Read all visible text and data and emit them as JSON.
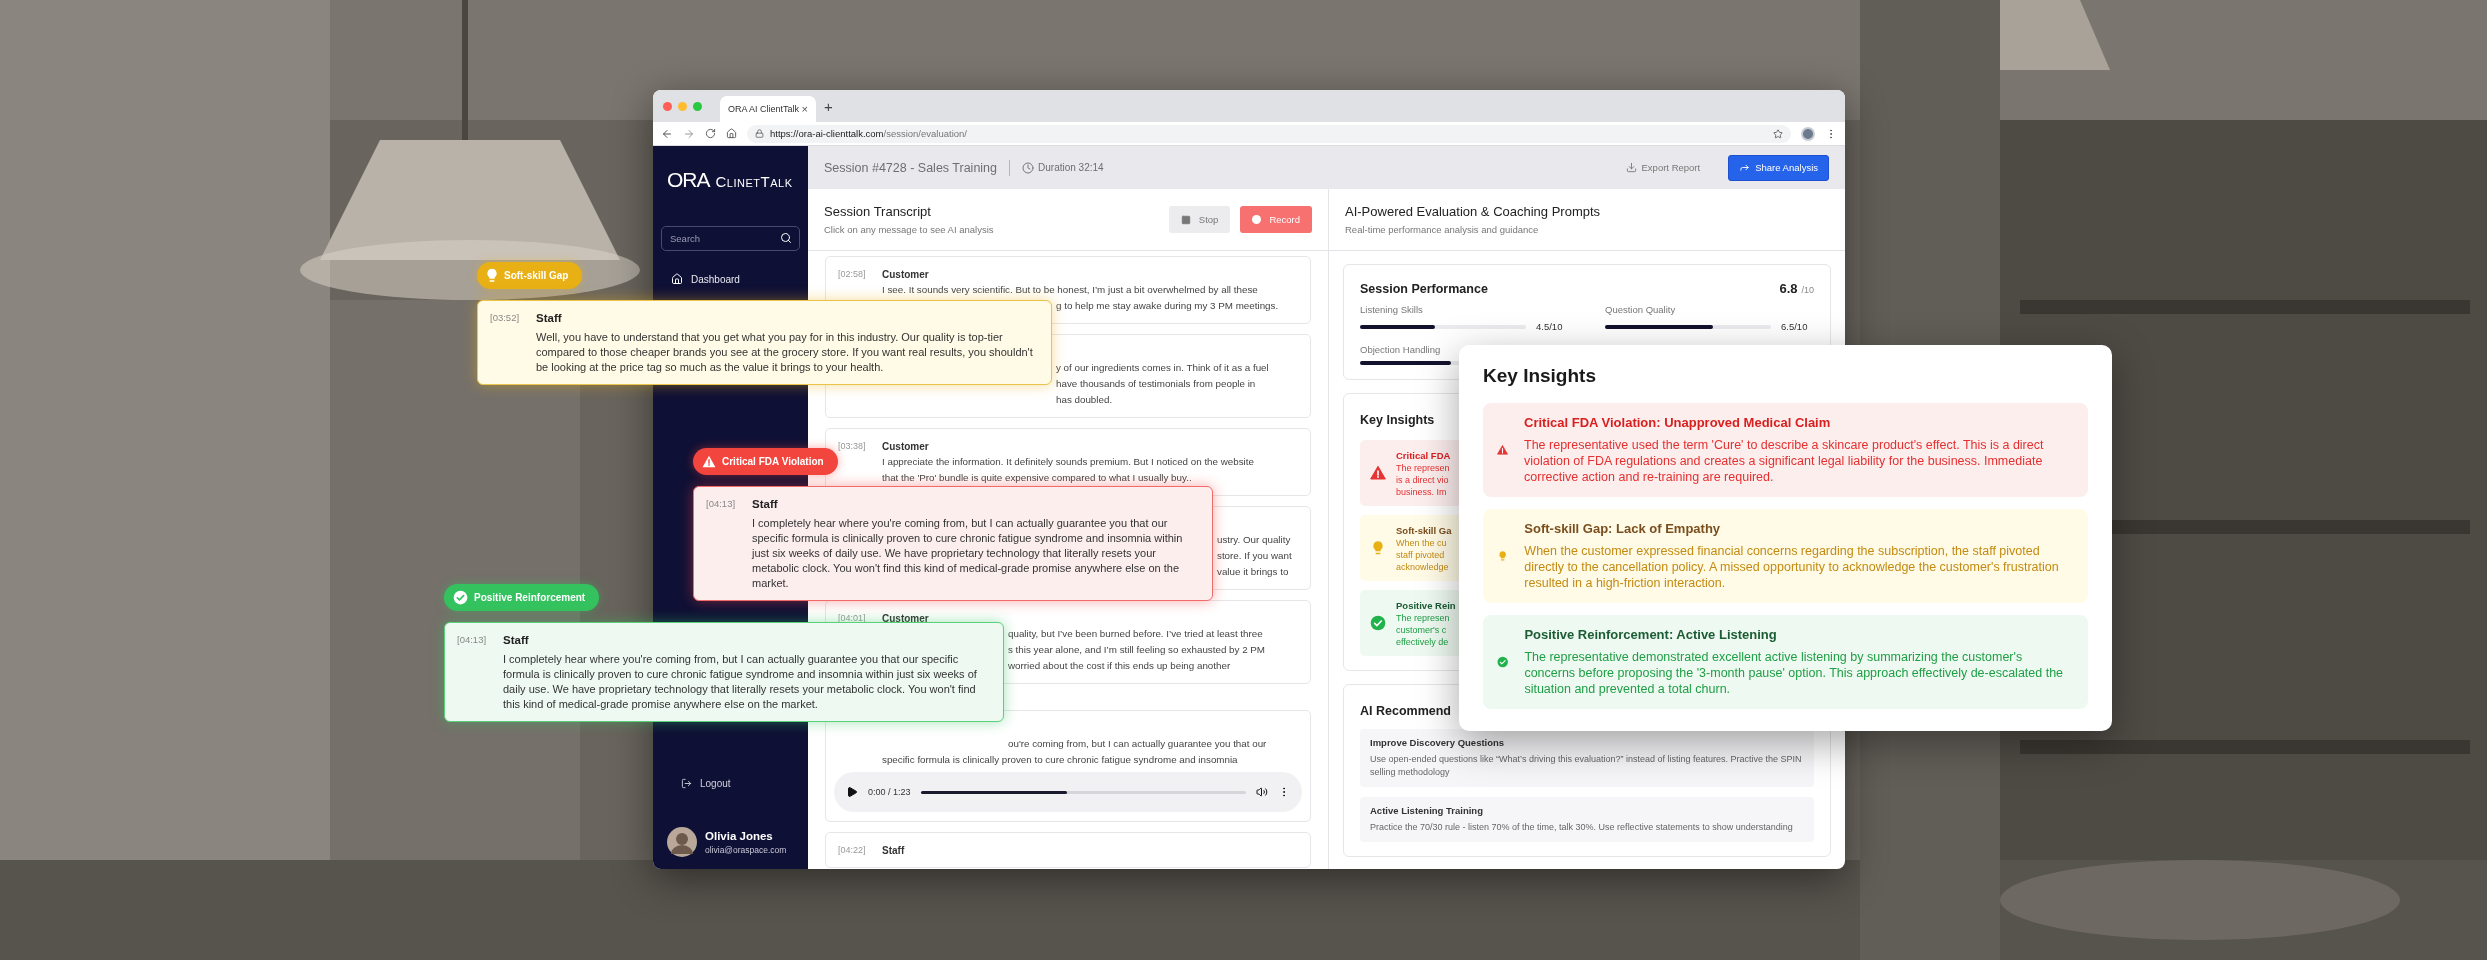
{
  "browser": {
    "tab_title": "ORA AI ClientTalk",
    "tab_close": "×",
    "new_tab": "+",
    "url_domain": "https://ora-ai-clienttalk.com",
    "url_path": "/session/evaluation/"
  },
  "sidebar": {
    "logo_mark": "ORA",
    "logo_name": "ClinetTalk",
    "search": {
      "placeholder": "Search"
    },
    "nav": [
      {
        "label": "Dashboard",
        "kind": "home"
      }
    ],
    "logout": "Logout",
    "user": {
      "name": "Olivia Jones",
      "email": "olivia@oraspace.com"
    }
  },
  "header": {
    "session": "Session #4728 - Sales Training",
    "duration": "Duration 32:14",
    "export": "Export Report",
    "share": "Share Analysis"
  },
  "transcript": {
    "title": "Session Transcript",
    "subtitle": "Click on any message to see AI analysis",
    "stop": "Stop",
    "record": "Record",
    "messages": [
      {
        "time": "[02:58]",
        "speaker": "Customer",
        "lines": [
          {
            "kind": "full",
            "text": "I see. It sounds very scientific. But to be honest, I’m just a bit overwhelmed by all these"
          },
          {
            "kind": "tail",
            "text": "g to help me stay awake during my 3 PM meetings."
          }
        ]
      },
      {
        "lines": [
          {
            "kind": "tail",
            "text": "y of our ingredients comes in. Think of it as a fuel"
          },
          {
            "kind": "tail",
            "text": "have thousands of testimonials from people in"
          },
          {
            "kind": "tail",
            "text": "has doubled."
          }
        ]
      },
      {
        "time": "[03:38]",
        "speaker": "Customer",
        "lines": [
          {
            "kind": "full",
            "text": "I appreciate the information. It definitely sounds premium. But I noticed on the website"
          },
          {
            "kind": "full",
            "text": "that the 'Pro' bundle is quite expensive compared to what I usually buy.."
          }
        ]
      },
      {
        "lines": [
          {
            "kind": "tail",
            "text": "ustry. Our quality"
          },
          {
            "kind": "tail",
            "text": "store. If you want"
          },
          {
            "kind": "tail",
            "text": "value it brings to"
          }
        ]
      },
      {
        "time": "[04:01]",
        "speaker": "Customer",
        "lines": [
          {
            "kind": "tail",
            "text": "quality, but I’ve been burned before. I’ve tried at least three"
          },
          {
            "kind": "tail",
            "text": "s this year alone, and I’m still feeling so exhausted by 2 PM"
          },
          {
            "kind": "tail",
            "text": "worried about the cost if this ends up being another"
          }
        ]
      },
      {
        "lines": [
          {
            "kind": "tail",
            "text": "ou're coming from, but I can actually guarantee you that our"
          },
          {
            "kind": "full",
            "text": "specific formula is clinically proven to cure chronic fatigue syndrome and insomnia"
          }
        ],
        "player": {
          "time": "0:00 / 1:23",
          "level": 0.45
        }
      },
      {
        "time": "[04:22]",
        "speaker": "Staff"
      }
    ]
  },
  "evaluation": {
    "title": "AI-Powered Evaluation & Coaching Prompts",
    "subtitle": "Real-time performance analysis and guidance",
    "performance": {
      "title": "Session Performance",
      "score": "6.8",
      "score_max": "/10",
      "metrics": [
        {
          "label": "Listening Skills",
          "value": "4.5/10",
          "level": 0.45
        },
        {
          "label": "Question Quality",
          "value": "6.5/10",
          "level": 0.65
        },
        {
          "label": "Objection Handling",
          "level": 0.55
        }
      ]
    },
    "insights": {
      "title": "Key Insights",
      "items": [
        {
          "kind": "critical",
          "title": "Critical FDA",
          "lines": [
            "The represen",
            "is a direct vio",
            "business. Im"
          ]
        },
        {
          "kind": "soft",
          "title": "Soft-skill Ga",
          "lines": [
            "When the cu",
            "staff pivoted",
            "acknowledge"
          ]
        },
        {
          "kind": "positive",
          "title": "Positive Rein",
          "lines": [
            "The represen",
            "customer's c",
            "effectively de"
          ]
        }
      ]
    },
    "recommendations": {
      "title": "AI Recommend",
      "items": [
        {
          "title": "Improve Discovery Questions",
          "text": "Use open-ended questions like “What’s driving this evaluation?” instead of listing features. Practive the SPIN selling methodology"
        },
        {
          "title": "Active Listening Training",
          "text": "Practice the 70/30 rule - listen 70% of the time, talk 30%. Use reflective statements to show understanding"
        }
      ]
    }
  },
  "highlights": [
    {
      "kind": "soft",
      "badge": "Soft-skill Gap",
      "time": "[03:52]",
      "speaker": "Staff",
      "text": "Well, you have to understand that you get what you pay for in this industry. Our quality is top-tier compared to those cheaper brands you see at the grocery store. If you want real results, you shouldn't be looking at the price tag so much as the value it brings to your health."
    },
    {
      "kind": "critical",
      "badge": "Critical FDA Violation",
      "time": "[04:13]",
      "speaker": "Staff",
      "text": "I completely hear where you're coming from, but I can actually guarantee you that our specific formula is clinically proven to cure chronic fatigue syndrome and insomnia within just six weeks of daily use. We have proprietary technology that literally resets your metabolic clock. You won't find this kind of medical-grade promise anywhere else on the market."
    },
    {
      "kind": "positive",
      "badge": "Positive Reinforcement",
      "time": "[04:13]",
      "speaker": "Staff",
      "text": "I completely hear where you're coming from, but I can actually guarantee you that our specific formula is clinically proven to cure chronic fatigue syndrome and insomnia within just six weeks of daily use. We have proprietary technology that literally resets your metabolic clock. You won't find this kind of medical-grade promise anywhere else on the market."
    }
  ],
  "insights_popup": {
    "title": "Key Insights",
    "items": [
      {
        "kind": "critical",
        "title": "Critical FDA Violation: Unapproved Medical Claim",
        "text": "The representative used the term 'Cure' to describe a skincare product's effect. This is a direct violation of FDA regulations and creates a significant legal liability for the business. Immediate corrective action and re-training are required."
      },
      {
        "kind": "soft",
        "title": "Soft-skill Gap: Lack of Empathy",
        "text": "When the customer expressed financial concerns regarding the subscription, the staff pivoted directly to the cancellation policy. A missed opportunity to acknowledge the customer's frustration resulted in a high-friction interaction."
      },
      {
        "kind": "positive",
        "title": "Positive Reinforcement: Active Listening",
        "text": "The representative demonstrated excellent active listening by summarizing the customer's concerns before proposing the '3-month pause' option. This approach effectively de-escalated the situation and prevented a total churn."
      }
    ]
  }
}
